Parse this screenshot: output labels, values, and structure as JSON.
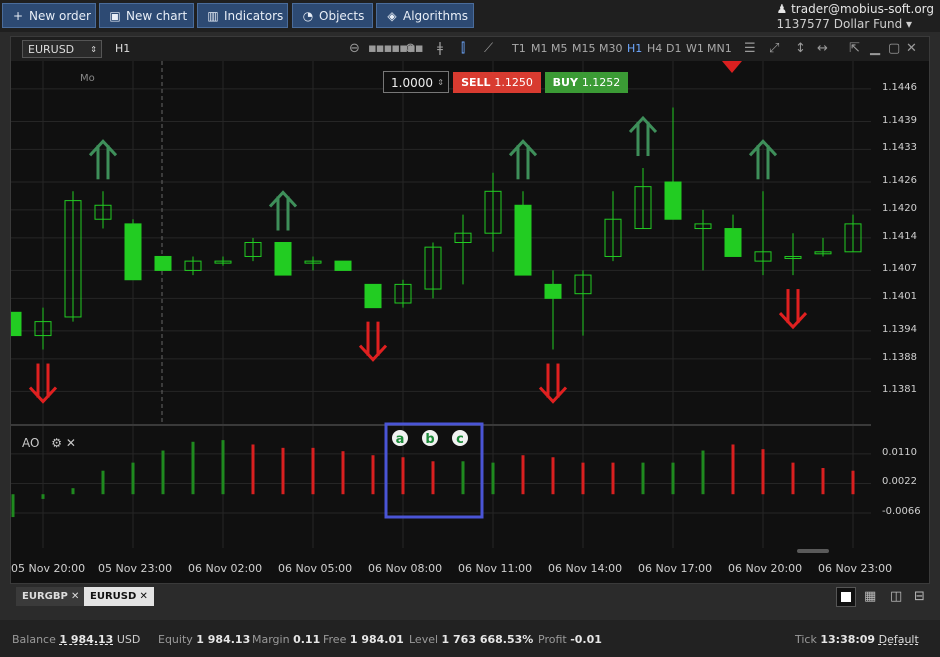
{
  "toolbar": {
    "new_order": "New order",
    "new_chart": "New chart",
    "indicators": "Indicators",
    "objects": "Objects",
    "algorithms": "Algorithms"
  },
  "account": {
    "email": "trader@mobius-soft.org",
    "id_fund": "1137577  Dollar Fund"
  },
  "chart_header": {
    "symbol": "EURUSD",
    "timeframe": "H1",
    "timeframes": [
      "T1",
      "M1",
      "M5",
      "M15",
      "M30",
      "H1",
      "H4",
      "D1",
      "W1",
      "MN1"
    ],
    "active_timeframe": "H1"
  },
  "trade_panel": {
    "quantity": "1.0000",
    "sell_label": "SELL",
    "sell_price": "1.1250",
    "buy_label": "BUY",
    "buy_price": "1.1252"
  },
  "session_marker": "Mo",
  "indicator_label": "AO",
  "annotations": [
    "a",
    "b",
    "c"
  ],
  "colors": {
    "up": "#22cc22",
    "down": "#e02020",
    "ao_up": "#1f8a1f",
    "ao_down": "#d92020",
    "arrow_up": "#3e8f5a",
    "arrow_down": "#e02020",
    "highlight": "#4a55d6"
  },
  "chart_data": {
    "type": "candlestick",
    "price_axis": {
      "ticks": [
        "1.1446",
        "1.1439",
        "1.1433",
        "1.1426",
        "1.1420",
        "1.1414",
        "1.1407",
        "1.1401",
        "1.1394",
        "1.1388",
        "1.1381"
      ],
      "ylim": [
        1.1374,
        1.1452
      ]
    },
    "ao_axis": {
      "ticks": [
        "0.0110",
        "0.0022",
        "-0.0066"
      ],
      "ylim": [
        -0.017,
        0.019
      ]
    },
    "time_labels": [
      "05 Nov 20:00",
      "05 Nov 23:00",
      "06 Nov 02:00",
      "06 Nov 05:00",
      "06 Nov 08:00",
      "06 Nov 11:00",
      "06 Nov 14:00",
      "06 Nov 17:00",
      "06 Nov 20:00",
      "06 Nov 23:00"
    ],
    "candles": [
      {
        "o": 1.1398,
        "h": 1.1398,
        "l": 1.1393,
        "c": 1.1393
      },
      {
        "o": 1.1393,
        "h": 1.1399,
        "l": 1.139,
        "c": 1.1396
      },
      {
        "o": 1.1397,
        "h": 1.1424,
        "l": 1.1396,
        "c": 1.1422
      },
      {
        "o": 1.1418,
        "h": 1.1424,
        "l": 1.1416,
        "c": 1.1421
      },
      {
        "o": 1.1417,
        "h": 1.1418,
        "l": 1.1405,
        "c": 1.1405
      },
      {
        "o": 1.141,
        "h": 1.141,
        "l": 1.1407,
        "c": 1.1407
      },
      {
        "o": 1.1407,
        "h": 1.141,
        "l": 1.1406,
        "c": 1.1409
      },
      {
        "o": 1.1409,
        "h": 1.141,
        "l": 1.1408,
        "c": 1.1409
      },
      {
        "o": 1.141,
        "h": 1.1414,
        "l": 1.1409,
        "c": 1.1413
      },
      {
        "o": 1.1413,
        "h": 1.1413,
        "l": 1.1406,
        "c": 1.1406
      },
      {
        "o": 1.1409,
        "h": 1.141,
        "l": 1.1407,
        "c": 1.1409
      },
      {
        "o": 1.1409,
        "h": 1.1409,
        "l": 1.1407,
        "c": 1.1407
      },
      {
        "o": 1.1404,
        "h": 1.1404,
        "l": 1.1399,
        "c": 1.1399
      },
      {
        "o": 1.14,
        "h": 1.1405,
        "l": 1.1399,
        "c": 1.1404
      },
      {
        "o": 1.1403,
        "h": 1.1413,
        "l": 1.1401,
        "c": 1.1412
      },
      {
        "o": 1.1413,
        "h": 1.1419,
        "l": 1.1404,
        "c": 1.1415
      },
      {
        "o": 1.1415,
        "h": 1.1428,
        "l": 1.1411,
        "c": 1.1424
      },
      {
        "o": 1.1421,
        "h": 1.1424,
        "l": 1.1406,
        "c": 1.1406
      },
      {
        "o": 1.1404,
        "h": 1.1407,
        "l": 1.139,
        "c": 1.1401
      },
      {
        "o": 1.1402,
        "h": 1.1407,
        "l": 1.1393,
        "c": 1.1406
      },
      {
        "o": 1.141,
        "h": 1.1424,
        "l": 1.1409,
        "c": 1.1418
      },
      {
        "o": 1.1416,
        "h": 1.1429,
        "l": 1.1416,
        "c": 1.1425
      },
      {
        "o": 1.1426,
        "h": 1.1442,
        "l": 1.1418,
        "c": 1.1418
      },
      {
        "o": 1.1416,
        "h": 1.142,
        "l": 1.1407,
        "c": 1.1417
      },
      {
        "o": 1.1416,
        "h": 1.1419,
        "l": 1.141,
        "c": 1.141
      },
      {
        "o": 1.1409,
        "h": 1.1424,
        "l": 1.1406,
        "c": 1.1411
      },
      {
        "o": 1.141,
        "h": 1.1415,
        "l": 1.1406,
        "c": 1.141
      },
      {
        "o": 1.1411,
        "h": 1.1414,
        "l": 1.141,
        "c": 1.1411
      },
      {
        "o": 1.1411,
        "h": 1.1419,
        "l": 1.1411,
        "c": 1.1417
      }
    ],
    "ao": [
      -0.0078,
      -0.0024,
      0.0008,
      0.006,
      0.0084,
      0.012,
      0.0146,
      0.0151,
      0.0138,
      0.0128,
      0.0128,
      0.0118,
      0.0106,
      0.01,
      0.0088,
      0.0088,
      0.0084,
      0.0106,
      0.01,
      0.0084,
      0.0084,
      0.0084,
      0.0084,
      0.012,
      0.0138,
      0.0124,
      0.0084,
      0.0068,
      0.006
    ],
    "ao_colors": [
      "g",
      "g",
      "g",
      "g",
      "g",
      "g",
      "g",
      "g",
      "r",
      "r",
      "r",
      "r",
      "r",
      "r",
      "r",
      "g",
      "g",
      "r",
      "r",
      "r",
      "r",
      "g",
      "g",
      "g",
      "r",
      "r",
      "r",
      "r",
      "r"
    ],
    "signals": [
      {
        "i": 1,
        "dir": "down"
      },
      {
        "i": 3,
        "dir": "up"
      },
      {
        "i": 9,
        "dir": "up"
      },
      {
        "i": 12,
        "dir": "down"
      },
      {
        "i": 17,
        "dir": "up"
      },
      {
        "i": 18,
        "dir": "down"
      },
      {
        "i": 21,
        "dir": "up"
      },
      {
        "i": 25,
        "dir": "up"
      },
      {
        "i": 26,
        "dir": "down"
      }
    ]
  },
  "tabs": [
    {
      "label": "EURGBP",
      "active": false
    },
    {
      "label": "EURUSD",
      "active": true
    }
  ],
  "status": {
    "balance_label": "Balance",
    "balance_value": "1 984.13",
    "balance_ccy": "USD",
    "equity_label": "Equity",
    "equity_value": "1 984.13",
    "margin_label": "Margin",
    "margin_value": "0.11",
    "free_label": "Free",
    "free_value": "1 984.01",
    "level_label": "Level",
    "level_value": "1 763 668.53%",
    "profit_label": "Profit",
    "profit_value": "-0.01",
    "tick_label": "Tick",
    "tick_value": "13:38:09",
    "tick_mode": "Default"
  }
}
